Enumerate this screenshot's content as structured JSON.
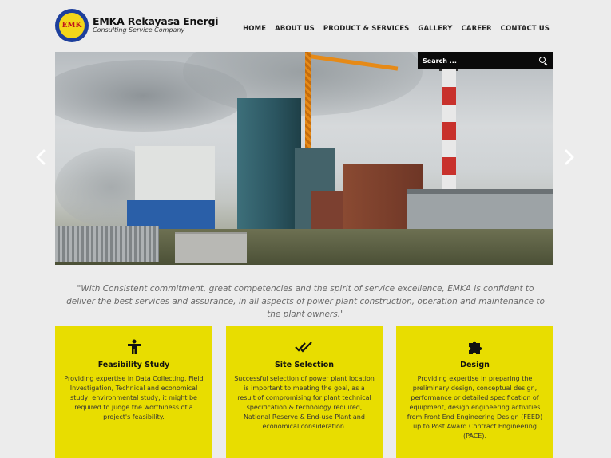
{
  "brand": {
    "logo_text": "EMK",
    "name": "EMKA Rekayasa Energi",
    "tagline": "Consulting Service Company"
  },
  "nav": {
    "items": [
      "HOME",
      "ABOUT US",
      "PRODUCT & SERVICES",
      "GALLERY",
      "CAREER",
      "CONTACT US"
    ]
  },
  "search": {
    "placeholder": "Search ..."
  },
  "hero": {
    "image_icon": "power-plant-construction-photo",
    "prev_icon": "chevron-left-icon",
    "next_icon": "chevron-right-icon"
  },
  "quote": "\"With Consistent commitment, great competencies and the spirit of service excellence, EMKA is confident to deliver the best services and assurance, in all aspects of power plant construction, operation and maintenance to the plant owners.\"",
  "services": [
    {
      "icon": "person-icon",
      "title": "Feasibility Study",
      "text": "Providing expertise in Data Collecting, Field Investigation, Technical and economical study, environmental study, it might be required to judge the worthiness of a project's feasibility."
    },
    {
      "icon": "double-check-icon",
      "title": "Site Selection",
      "text": "Successful selection of power plant location is important to meeting the goal, as a result of compromising for plant technical specification & technology required, National Reserve & End-use Plant and economical consideration."
    },
    {
      "icon": "puzzle-icon",
      "title": "Design",
      "text": "Providing expertise in preparing the preliminary design, conceptual design, performance or detailed specification of equipment, design engineering activities from Front End Engineering Design (FEED) up to Post Award Contract Engineering (PACE)."
    }
  ],
  "colors": {
    "background": "#ececec",
    "card_yellow": "#e8dd00",
    "search_bar": "#0a0a0a"
  }
}
